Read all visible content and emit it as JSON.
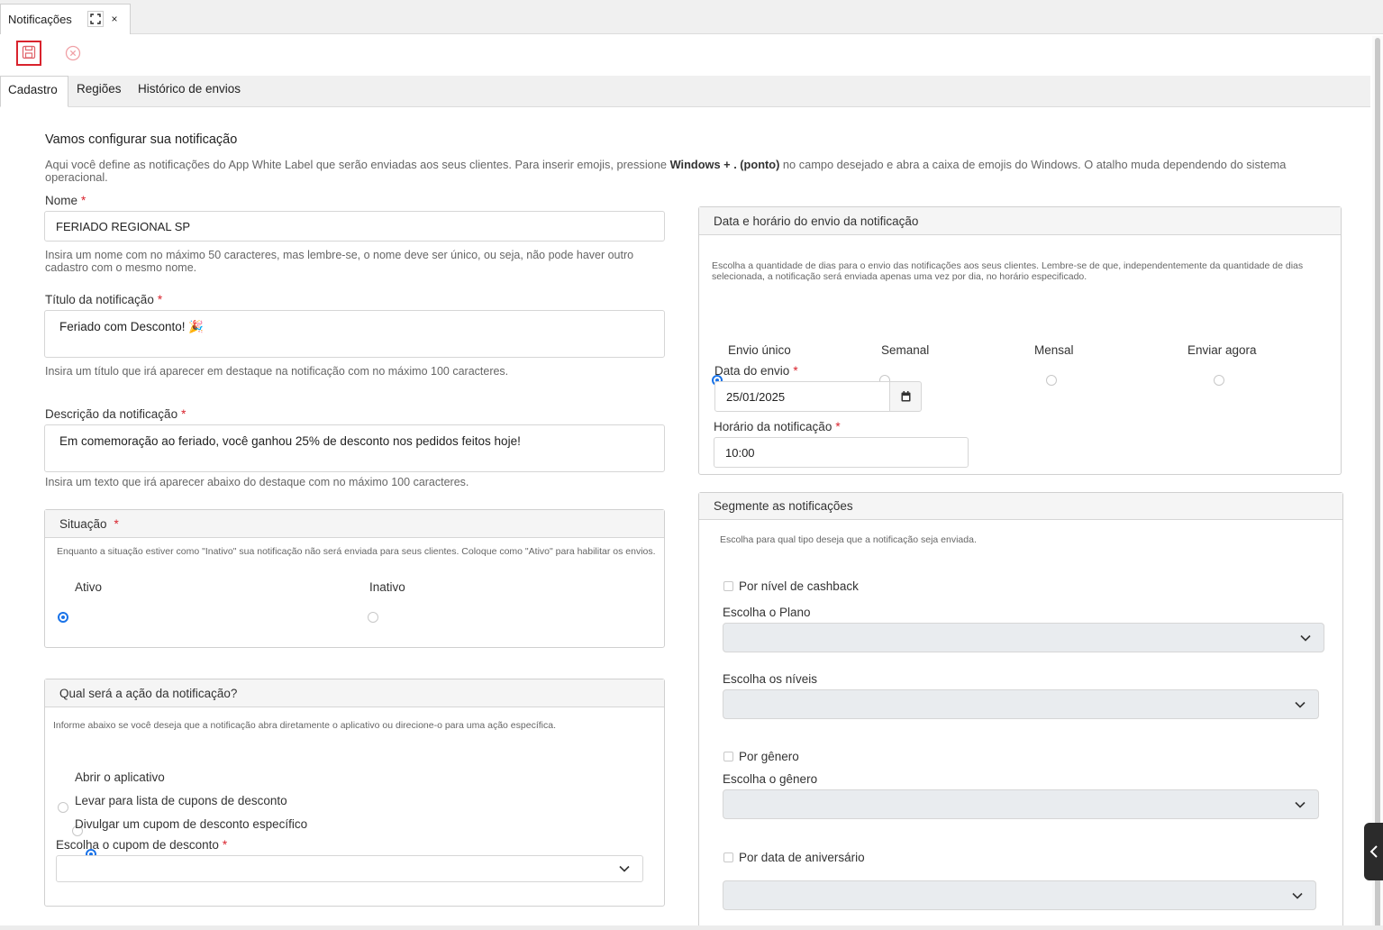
{
  "window_tab": {
    "title": "Notificações",
    "expand_icon": "expand-icon",
    "close_icon": "close-icon",
    "close_label": "×"
  },
  "toolbar": {
    "save_icon": "floppy-disk-icon",
    "cancel_icon": "cancel-circle-icon"
  },
  "tabs": [
    {
      "label": "Cadastro",
      "active": true
    },
    {
      "label": "Regiões",
      "active": false
    },
    {
      "label": "Histórico de envios",
      "active": false
    }
  ],
  "intro": {
    "title": "Vamos configurar sua notificação",
    "text_before": "Aqui você define as notificações do App White Label que serão enviadas aos seus clientes. Para inserir emojis, pressione ",
    "text_bold": "Windows + . (ponto)",
    "text_after": " no campo desejado e abra a caixa de emojis do Windows. O atalho muda dependendo do sistema operacional."
  },
  "form": {
    "required_mark": "*",
    "name": {
      "label": "Nome",
      "value": "FERIADO REGIONAL SP",
      "help": "Insira um nome com no máximo 50 caracteres, mas lembre-se, o nome deve ser único, ou seja, não pode haver outro cadastro com o mesmo nome."
    },
    "title": {
      "label": "Título da notificação",
      "value": "Feriado com Desconto! 🎉",
      "help": "Insira um título que irá aparecer em destaque na notificação com no máximo 100 caracteres."
    },
    "description": {
      "label": "Descrição da notificação",
      "value": "Em comemoração ao feriado, você ganhou 25% de desconto nos pedidos feitos hoje!",
      "help": "Insira um texto que irá aparecer abaixo do destaque com no máximo 100 caracteres."
    }
  },
  "situation": {
    "title": "Situação",
    "help": "Enquanto a situação estiver como \"Inativo\" sua notificação não será enviada para seus clientes. Coloque como \"Ativo\" para habilitar os envios.",
    "options": [
      {
        "label": "Ativo",
        "selected": true
      },
      {
        "label": "Inativo",
        "selected": false
      }
    ]
  },
  "action": {
    "title": "Qual será a ação da notificação?",
    "help": "Informe abaixo se você deseja que a notificação abra diretamente o aplicativo ou direcione-o para uma ação específica.",
    "options": [
      {
        "label": "Abrir o aplicativo",
        "selected": false
      },
      {
        "label": "Levar para lista de cupons de desconto",
        "selected": false
      },
      {
        "label": "Divulgar um cupom de desconto específico",
        "selected": true
      }
    ],
    "coupon_label": "Escolha o cupom de desconto",
    "coupon_value": ""
  },
  "schedule": {
    "title": "Data e horário do envio da notificação",
    "help": "Escolha a quantidade de dias para o envio das notificações aos seus clientes. Lembre-se de que, independentemente da quantidade de dias selecionada, a notificação será enviada apenas uma vez por dia, no horário especificado.",
    "options": [
      {
        "label": "Envio único",
        "selected": true
      },
      {
        "label": "Semanal",
        "selected": false
      },
      {
        "label": "Mensal",
        "selected": false
      },
      {
        "label": "Enviar agora",
        "selected": false
      }
    ],
    "date_label": "Data do envio",
    "date_value": "25/01/2025",
    "calendar_icon": "calendar-icon",
    "time_label": "Horário da notificação",
    "time_value": "10:00"
  },
  "segment": {
    "title": "Segmente as notificações",
    "help": "Escolha para qual tipo deseja que a notificação seja enviada.",
    "cashback_label": "Por nível de cashback",
    "plan_label": "Escolha o Plano",
    "levels_label": "Escolha os níveis",
    "gender_check_label": "Por gênero",
    "gender_label": "Escolha o gênero",
    "birthday_label": "Por data de aniversário"
  },
  "colors": {
    "accent": "#1a73e8",
    "danger": "#d9232d",
    "panel_head": "#f5f5f5",
    "select_gray": "#e9ecef"
  }
}
